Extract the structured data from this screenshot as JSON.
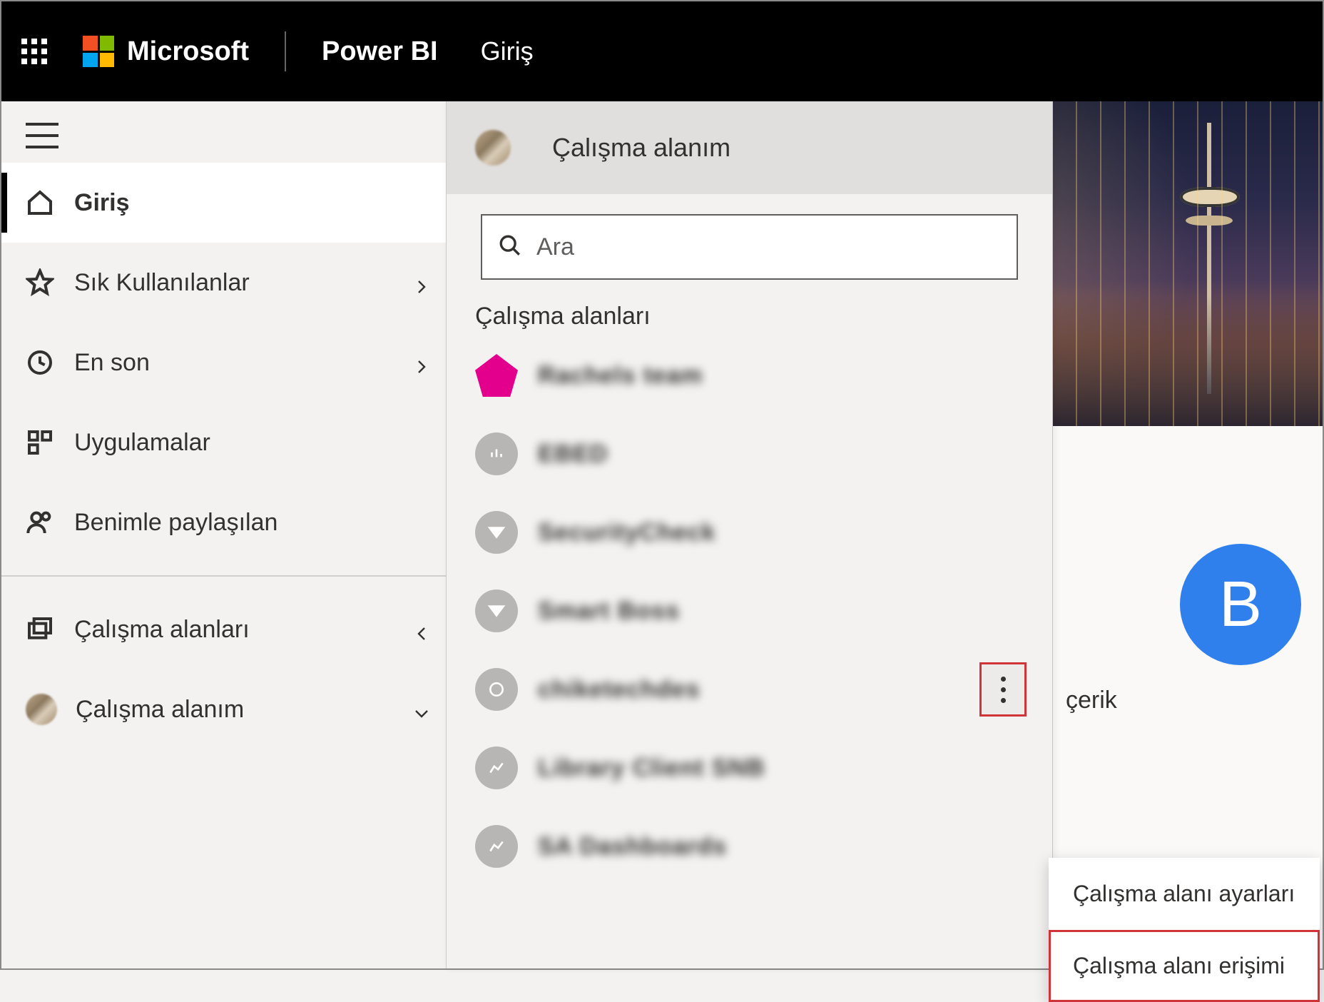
{
  "header": {
    "brand": "Microsoft",
    "product": "Power BI",
    "page": "Giriş"
  },
  "nav": {
    "home": "Giriş",
    "favorites": "Sık Kullanılanlar",
    "recent": "En son",
    "apps": "Uygulamalar",
    "shared": "Benimle paylaşılan",
    "workspaces": "Çalışma alanları",
    "my_workspace": "Çalışma alanım"
  },
  "flyout": {
    "header_title": "Çalışma alanım",
    "search_placeholder": "Ara",
    "section": "Çalışma alanları",
    "items": [
      {
        "name": "Rachels team"
      },
      {
        "name": "EBED"
      },
      {
        "name": "SecurityCheck"
      },
      {
        "name": "Smart Boss"
      },
      {
        "name": "chiketechdes"
      },
      {
        "name": "Library Client SNB"
      },
      {
        "name": "SA Dashboards"
      }
    ]
  },
  "context_menu": {
    "settings": "Çalışma alanı ayarları",
    "access": "Çalışma alanı erişimi"
  },
  "tile": {
    "avatar_letter": "B",
    "caption": "çerik"
  }
}
